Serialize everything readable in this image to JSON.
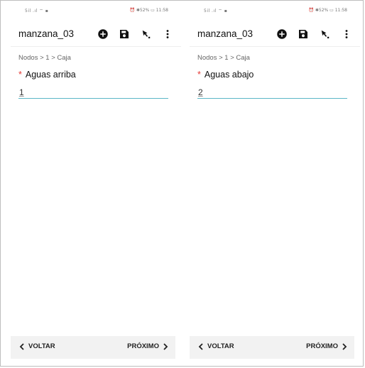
{
  "screens": [
    {
      "status": {
        "left": "5il .ıl ⌔ ▪",
        "right": "⏰ ✱52% ▭ 11:58"
      },
      "app_title": "manzana_03",
      "icons": [
        "add-circle-icon",
        "save-icon",
        "pick-arrow-icon",
        "more-vert-icon"
      ],
      "breadcrumb": "Nodos > 1 > Caja",
      "field": {
        "required_mark": "*",
        "label": "Aguas arriba",
        "value": "1"
      },
      "nav": {
        "prev_label": "VOLTAR",
        "next_label": "PRÓXIMO"
      }
    },
    {
      "status": {
        "left": "5il .ıl ⌔ ▪",
        "right": "⏰ ✱52% ▭ 11:58"
      },
      "app_title": "manzana_03",
      "icons": [
        "add-circle-icon",
        "save-icon",
        "pick-arrow-icon",
        "more-vert-icon"
      ],
      "breadcrumb": "Nodos > 1 > Caja",
      "field": {
        "required_mark": "*",
        "label": "Aguas abajo",
        "value": "2"
      },
      "nav": {
        "prev_label": "VOLTAR",
        "next_label": "PRÓXIMO"
      }
    }
  ],
  "colors": {
    "accent_underline": "#5bb7c6",
    "required": "#e53935",
    "bottom_bar": "#f2f2f2"
  }
}
